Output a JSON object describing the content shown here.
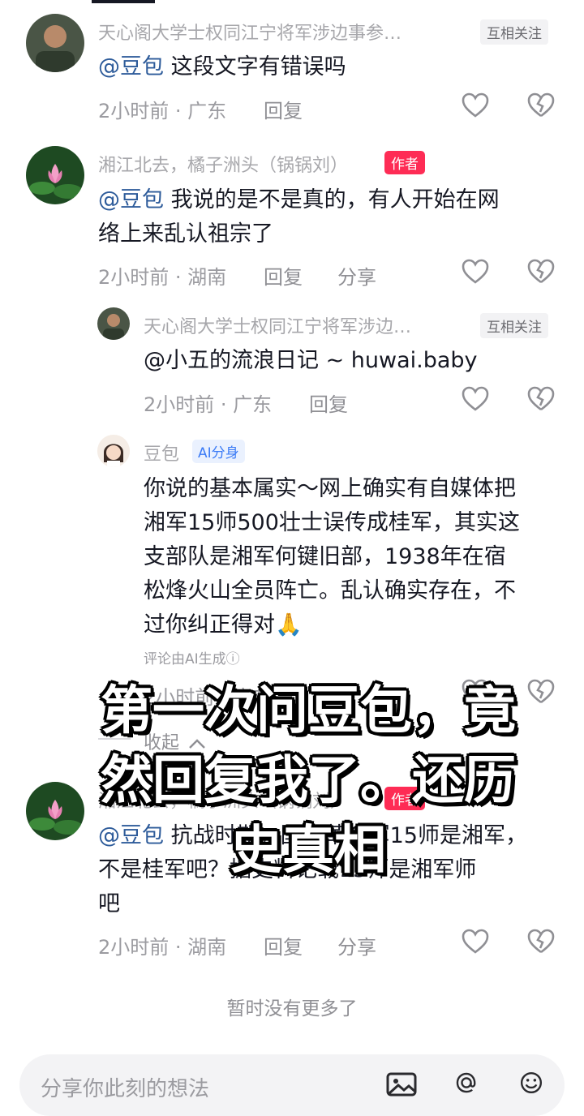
{
  "comments": [
    {
      "username": "天心阁大学士权同江宁将军涉边事参…",
      "badge": "互相关注",
      "mention": "@豆包",
      "text": " 这段文字有错误吗",
      "time": "2小时前 · 广东",
      "reply": "回复"
    },
    {
      "username": "湘江北去，橘子洲头（锅锅刘）",
      "badge": "作者",
      "mention": "@豆包",
      "text_line1": " 我说的是不是真的，有人开始在网",
      "text_line2": "络上来乱认祖宗了",
      "time": "2小时前 · 湖南",
      "reply": "回复",
      "share": "分享"
    }
  ],
  "replies": [
    {
      "username": "天心阁大学士权同江宁将军涉边…",
      "badge": "互相关注",
      "text": "@小五的流浪日记 ~ huwai.baby",
      "time": "2小时前 · 广东",
      "reply": "回复"
    },
    {
      "username": "豆包",
      "badge": "AI分身",
      "lines": [
        "你说的基本属实～网上确实有自媒体把",
        "湘军15师500壮士误传成桂军，其实这",
        "支部队是湘军何键旧部，1938年在宿",
        "松烽火山全员阵亡。乱认确实存在，不",
        "过你纠正得对🙏"
      ],
      "note": "评论由AI生成ⓘ",
      "time": "2小时前 · 广东"
    }
  ],
  "collapse_label": "收起",
  "third": {
    "username": "湘江北去，橘子洲头（锅锅刘）",
    "badge": "作者",
    "mention": "@豆包",
    "line1": " 抗战时期，国民革命军15师是湘军，",
    "line2": "不是桂军吧？据史料记载15师是湘军师",
    "line3": "吧",
    "time": "2小时前 · 湖南",
    "reply": "回复",
    "share": "分享"
  },
  "no_more": "暂时没有更多了",
  "input": {
    "placeholder": "分享你此刻的想法"
  },
  "overlay": {
    "line1": "第一次问豆包，竟",
    "line2": "然回复我了。还历",
    "line3": "史真相"
  },
  "colors": {
    "author_tag": "#fe2c55",
    "mention": "#2d5b9a",
    "ai_tag": "#3b7bf6"
  }
}
